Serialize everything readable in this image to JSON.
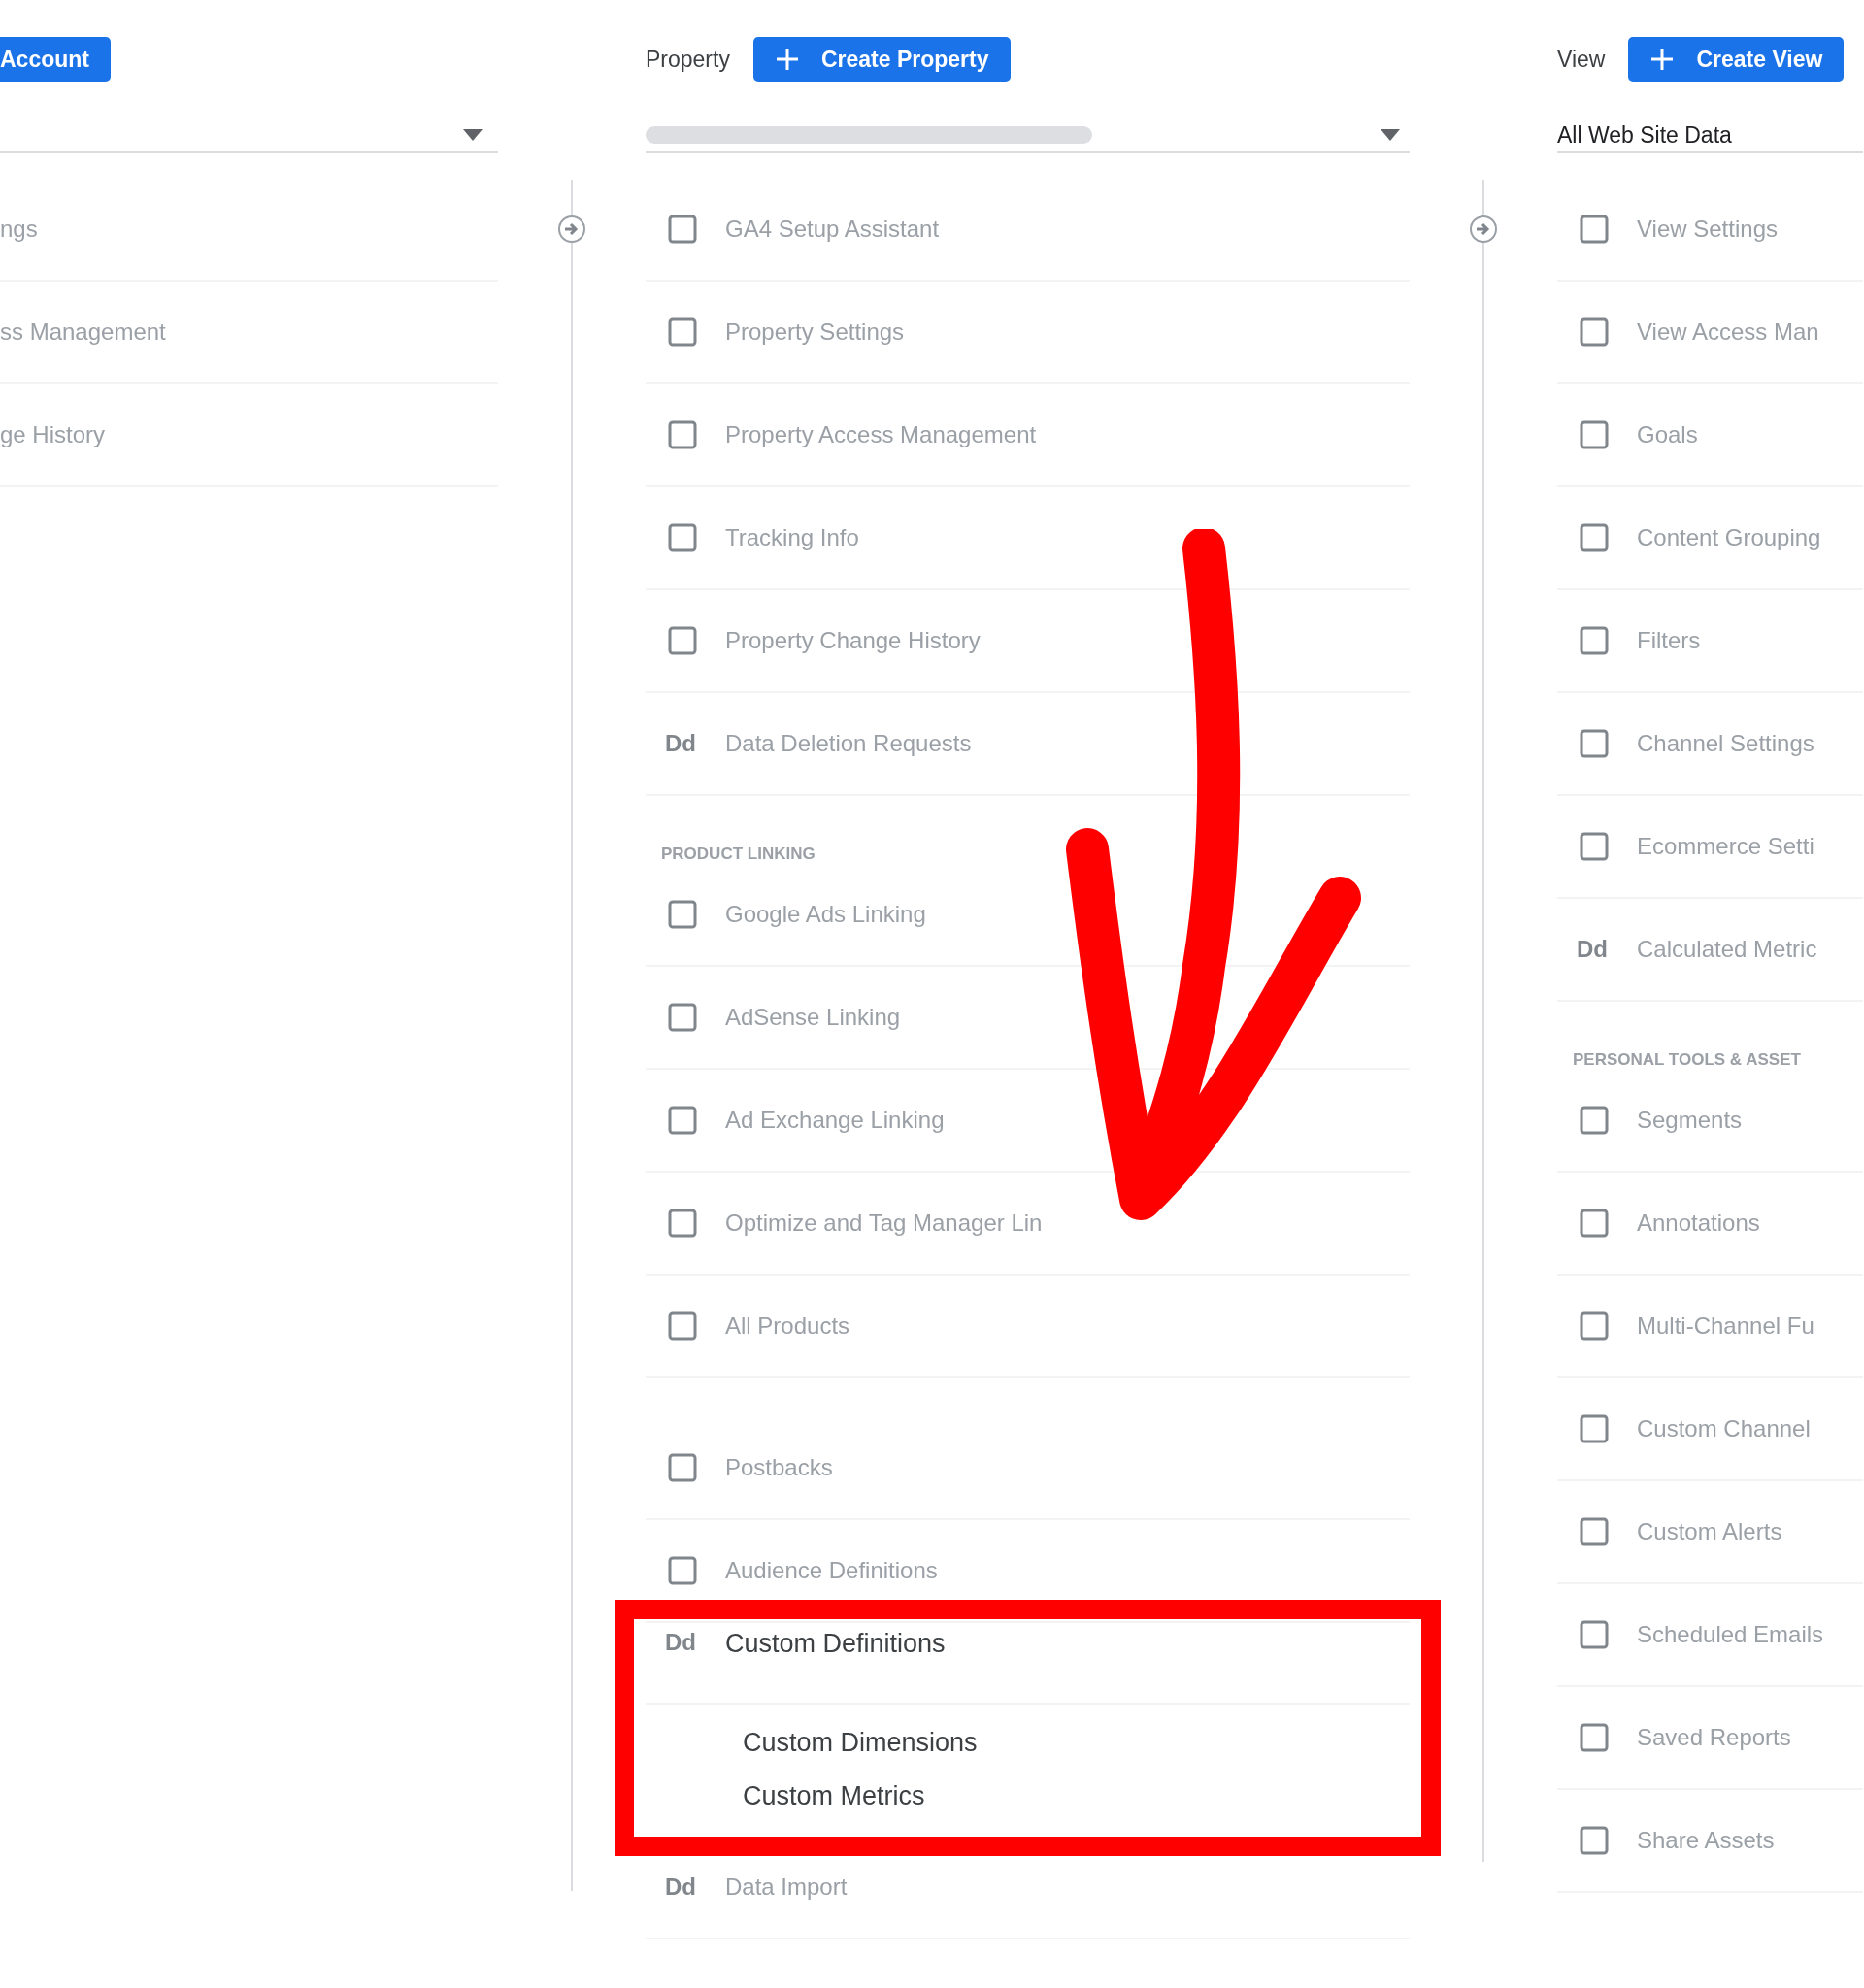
{
  "account_column": {
    "create_button": "Account",
    "items": [
      {
        "label": "ngs",
        "dimmed": true
      },
      {
        "label": "ss Management",
        "dimmed": true
      },
      {
        "label": "ge History",
        "dimmed": true
      }
    ]
  },
  "property_column": {
    "label": "Property",
    "create_button": "Create Property",
    "items": [
      {
        "kind": "item",
        "label": "GA4 Setup Assistant",
        "dimmed": true,
        "spaced": false
      },
      {
        "kind": "item",
        "label": "Property Settings",
        "dimmed": true,
        "spaced": false
      },
      {
        "kind": "item",
        "label": "Property Access Management",
        "dimmed": true,
        "spaced": false
      },
      {
        "kind": "item",
        "label": "Tracking Info",
        "dimmed": true,
        "spaced": false
      },
      {
        "kind": "item",
        "label": "Property Change History",
        "dimmed": true,
        "spaced": false
      },
      {
        "kind": "item",
        "icon_text": "Dd",
        "label": "Data Deletion Requests",
        "dimmed": true,
        "spaced": false
      },
      {
        "kind": "section",
        "label": "PRODUCT LINKING",
        "dimmed": true,
        "spaced": false
      },
      {
        "kind": "item",
        "label": "Google Ads Linking",
        "dimmed": true,
        "spaced": false
      },
      {
        "kind": "item",
        "label": "AdSense Linking",
        "dimmed": true,
        "spaced": false
      },
      {
        "kind": "item",
        "label": "Ad Exchange Linking",
        "dimmed": true,
        "spaced": false
      },
      {
        "kind": "item",
        "label": "Optimize and Tag Manager Lin",
        "dimmed": true,
        "spaced": false
      },
      {
        "kind": "item",
        "label": "All Products",
        "dimmed": true,
        "spaced": false
      },
      {
        "kind": "item",
        "label": "Postbacks",
        "dimmed": true,
        "spaced": true
      },
      {
        "kind": "item",
        "label": "Audience Definitions",
        "dimmed": true,
        "spaced": false
      },
      {
        "kind": "group",
        "icon_text": "Dd",
        "label": "Custom Definitions",
        "dimmed": false,
        "highlighted": true,
        "spaced": false,
        "children": [
          {
            "label": "Custom Dimensions"
          },
          {
            "label": "Custom Metrics"
          }
        ]
      },
      {
        "kind": "item",
        "icon_text": "Dd",
        "label": "Data Import",
        "dimmed": true,
        "spaced": false
      }
    ]
  },
  "view_column": {
    "label": "View",
    "create_button": "Create View",
    "selector_value": "All Web Site Data",
    "items": [
      {
        "kind": "item",
        "label": "View Settings",
        "dimmed": true,
        "spaced": false
      },
      {
        "kind": "item",
        "label": "View Access Man",
        "dimmed": true,
        "spaced": false
      },
      {
        "kind": "item",
        "label": "Goals",
        "dimmed": true,
        "spaced": false
      },
      {
        "kind": "item",
        "label": "Content Grouping",
        "dimmed": true,
        "spaced": false
      },
      {
        "kind": "item",
        "label": "Filters",
        "dimmed": true,
        "spaced": false
      },
      {
        "kind": "item",
        "label": "Channel Settings",
        "dimmed": true,
        "spaced": false
      },
      {
        "kind": "item",
        "label": "Ecommerce Setti",
        "dimmed": true,
        "spaced": false
      },
      {
        "kind": "item",
        "icon_text": "Dd",
        "label": "Calculated Metric",
        "dimmed": true,
        "spaced": false
      },
      {
        "kind": "section",
        "label": "PERSONAL TOOLS & ASSET",
        "dimmed": true,
        "spaced": false
      },
      {
        "kind": "item",
        "label": "Segments",
        "dimmed": true,
        "spaced": false
      },
      {
        "kind": "item",
        "label": "Annotations",
        "dimmed": true,
        "spaced": false
      },
      {
        "kind": "item",
        "label": "Multi-Channel Fu",
        "dimmed": true,
        "spaced": false
      },
      {
        "kind": "item",
        "label": "Custom Channel",
        "dimmed": true,
        "spaced": false
      },
      {
        "kind": "item",
        "label": "Custom Alerts",
        "dimmed": true,
        "spaced": false
      },
      {
        "kind": "item",
        "label": "Scheduled Emails",
        "dimmed": true,
        "spaced": false
      },
      {
        "kind": "item",
        "label": "Saved Reports",
        "dimmed": true,
        "spaced": false
      },
      {
        "kind": "item",
        "label": "Share Assets",
        "dimmed": true,
        "spaced": false
      }
    ]
  }
}
